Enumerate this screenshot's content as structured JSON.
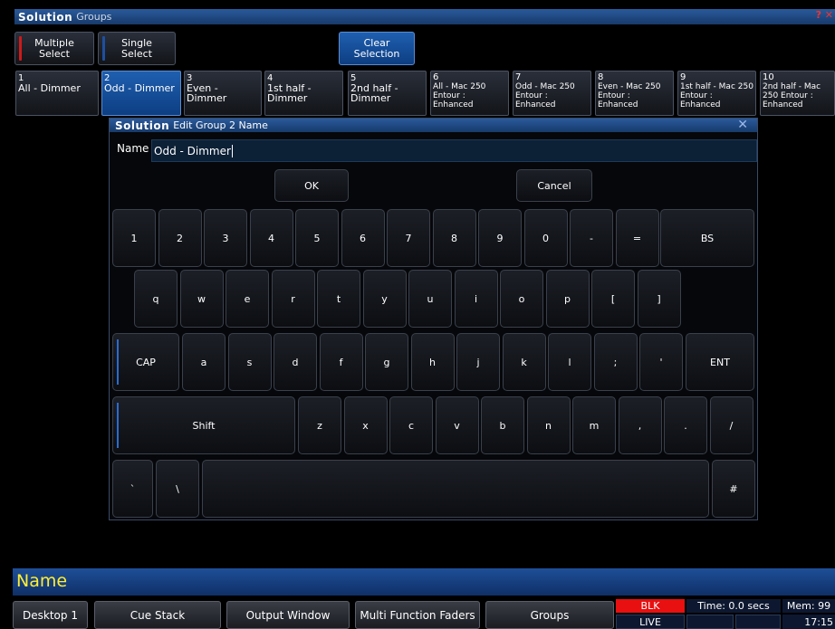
{
  "window": {
    "title": "Groups",
    "help": "? ✕"
  },
  "top_buttons": {
    "multiple": "Multiple Select",
    "single": "Single Select",
    "clear": "Clear Selection"
  },
  "groups": [
    {
      "num": "1",
      "label": "All - Dimmer"
    },
    {
      "num": "2",
      "label": "Odd - Dimmer"
    },
    {
      "num": "3",
      "label": "Even - Dimmer"
    },
    {
      "num": "4",
      "label": "1st half - Dimmer"
    },
    {
      "num": "5",
      "label": "2nd half - Dimmer"
    },
    {
      "num": "6",
      "label": "All - Mac 250 Entour : Enhanced"
    },
    {
      "num": "7",
      "label": "Odd - Mac 250 Entour : Enhanced"
    },
    {
      "num": "8",
      "label": "Even - Mac 250 Entour : Enhanced"
    },
    {
      "num": "9",
      "label": "1st half - Mac 250 Entour : Enhanced"
    },
    {
      "num": "10",
      "label": "2nd half - Mac 250 Entour : Enhanced"
    }
  ],
  "dialog": {
    "logo": "Solution",
    "title": "Edit Group 2 Name",
    "close": "✕",
    "name_label": "Name",
    "name_value": "Odd - Dimmer",
    "ok": "OK",
    "cancel": "Cancel"
  },
  "keyboard": {
    "row1": [
      "1",
      "2",
      "3",
      "4",
      "5",
      "6",
      "7",
      "8",
      "9",
      "0",
      "-",
      "=",
      "BS"
    ],
    "row2": [
      "q",
      "w",
      "e",
      "r",
      "t",
      "y",
      "u",
      "i",
      "o",
      "p",
      "[",
      "]"
    ],
    "row3": [
      "CAP",
      "a",
      "s",
      "d",
      "f",
      "g",
      "h",
      "j",
      "k",
      "l",
      ";",
      "'",
      "ENT"
    ],
    "row4": [
      "Shift",
      "z",
      "x",
      "c",
      "v",
      "b",
      "n",
      "m",
      ",",
      ".",
      "/"
    ],
    "row5": [
      "`",
      "\\",
      "",
      "#"
    ]
  },
  "command_line": "Name",
  "taskbar": [
    "Desktop 1",
    "Cue Stack",
    "Output Window",
    "Multi Function Faders",
    "Groups"
  ],
  "status": {
    "blk": "BLK",
    "live": "LIVE",
    "time": "Time: 0.0 secs",
    "mem": "Mem: 99",
    "clock": "17:15"
  },
  "colors": {
    "accent": "#1f5fb0",
    "blk": "#e81010",
    "cmd_text": "#ffee33"
  }
}
